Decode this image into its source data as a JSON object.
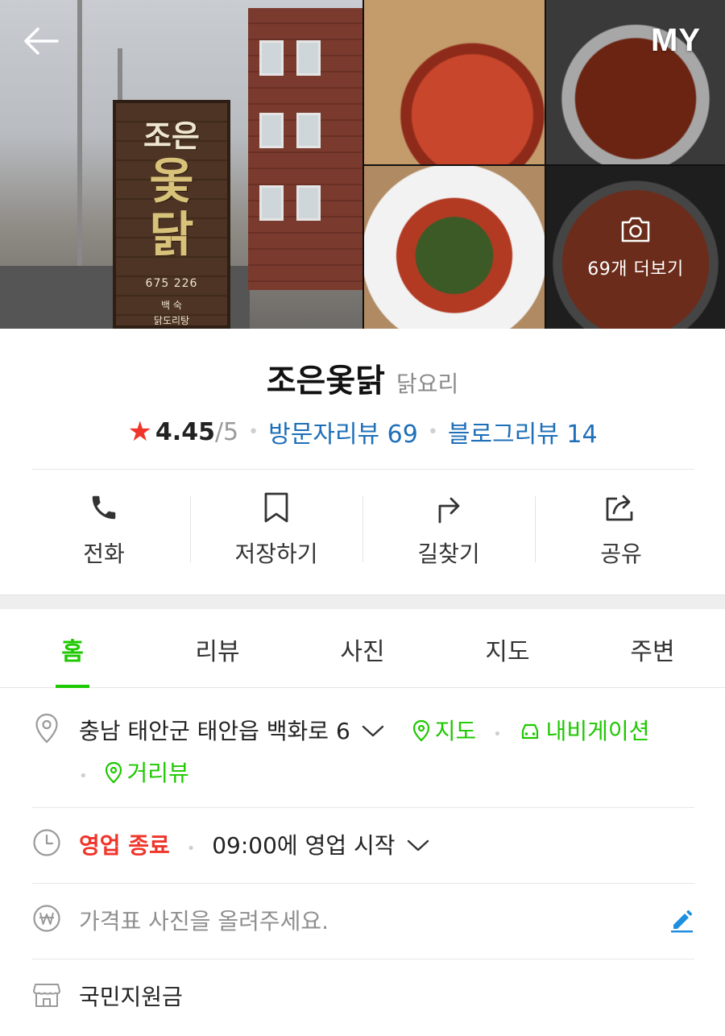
{
  "header": {
    "back_icon": "arrow-left-icon",
    "my_label": "MY",
    "more_photos_label": "69개 더보기",
    "sign": {
      "line1": "조은",
      "line2": "옻",
      "line3": "닭",
      "phone": "675 226",
      "sub1": "백 숙",
      "sub2": "닭도리탕"
    }
  },
  "place": {
    "name": "조은옻닭",
    "category": "닭요리",
    "rating": "4.45",
    "rating_max": "/5",
    "visitor_reviews": "방문자리뷰 69",
    "blog_reviews": "블로그리뷰 14"
  },
  "actions": [
    {
      "label": "전화",
      "icon": "phone-icon"
    },
    {
      "label": "저장하기",
      "icon": "bookmark-icon"
    },
    {
      "label": "길찾기",
      "icon": "directions-icon"
    },
    {
      "label": "공유",
      "icon": "share-icon"
    }
  ],
  "tabs": [
    {
      "label": "홈",
      "active": true
    },
    {
      "label": "리뷰"
    },
    {
      "label": "사진"
    },
    {
      "label": "지도"
    },
    {
      "label": "주변"
    }
  ],
  "info": {
    "address": "충남 태안군 태안읍 백화로 6",
    "map_link": "지도",
    "navigation_link": "내비게이션",
    "street_view_link": "거리뷰",
    "status": "영업 종료",
    "open_time": "09:00에 영업 시작",
    "price_placeholder": "가격표 사진을 올려주세요.",
    "support_fund": "국민지원금"
  },
  "colors": {
    "accent_green": "#1ec800",
    "link_blue": "#1e6fb8",
    "status_red": "#f0352b"
  }
}
